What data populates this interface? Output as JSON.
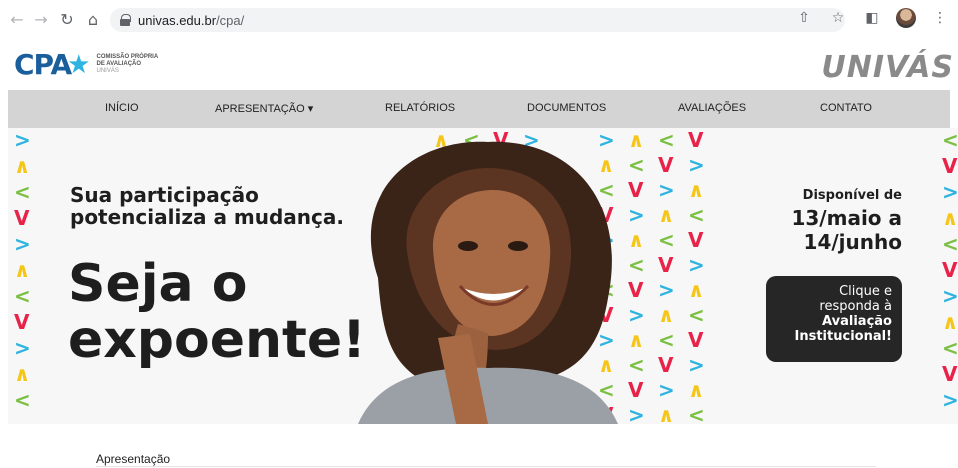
{
  "browser": {
    "url_host": "univas.edu.br",
    "url_path": "/cpa/",
    "icons": [
      "back-icon",
      "forward-icon",
      "reload-icon",
      "home-icon",
      "lock-icon",
      "share-icon",
      "star-icon",
      "sidebar-icon",
      "profile-avatar",
      "menu-icon"
    ]
  },
  "header": {
    "cpa_logo": "CPA",
    "cpa_sub1": "COMISSÃO PRÓPRIA",
    "cpa_sub2": "DE AVALIAÇÃO",
    "cpa_sub3": "UNIVÁS",
    "univas_logo": "UNIVÁS"
  },
  "nav": {
    "items": [
      {
        "label": "INÍCIO"
      },
      {
        "label": "APRESENTAÇÃO ▾"
      },
      {
        "label": "RELATÓRIOS"
      },
      {
        "label": "DOCUMENTOS"
      },
      {
        "label": "AVALIAÇÕES"
      },
      {
        "label": "CONTATO"
      }
    ]
  },
  "hero": {
    "line1": "Sua participação potencializa a mudança.",
    "line2": "Seja o expoente!",
    "avail_label": "Disponível de",
    "avail_date1": "13/maio a",
    "avail_date2": "14/junho",
    "cta_line1": "Clique e",
    "cta_line2": "responda à",
    "cta_line3": "Avaliação",
    "cta_line4": "Institucional!",
    "colors": {
      "blue": "#2fb3e0",
      "yellow": "#f5c518",
      "red": "#e8234a",
      "green": "#7bc043",
      "dark": "#1e1e1e"
    }
  },
  "content": {
    "section_title": "Apresentação"
  }
}
